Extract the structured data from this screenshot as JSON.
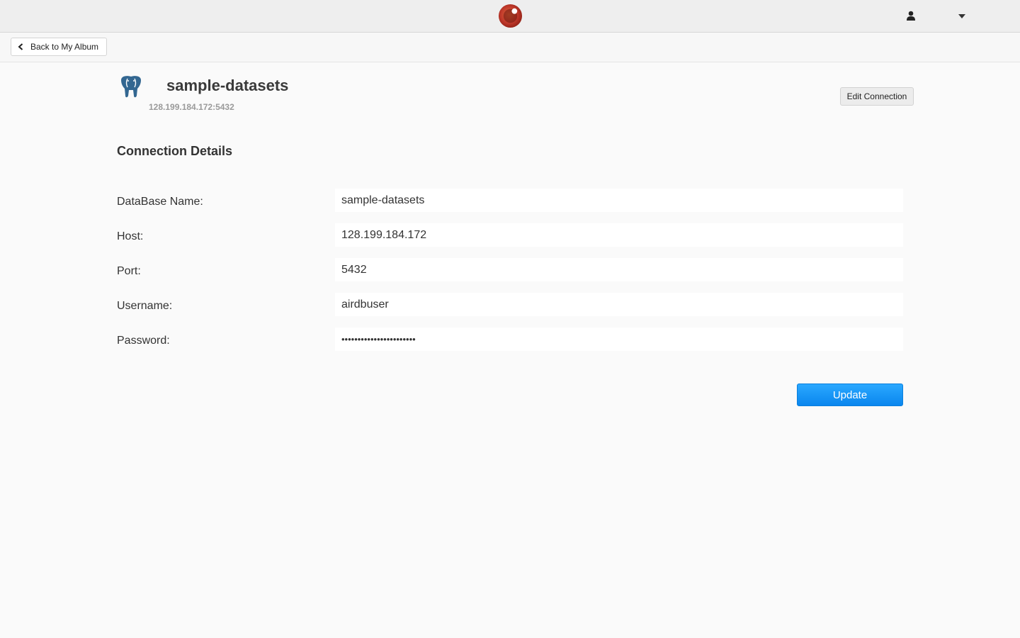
{
  "header": {
    "logo_icon": "app-logo-icon",
    "user_icon": "user-icon",
    "menu_icon": "chevron-down-icon"
  },
  "nav": {
    "back_label": "Back to My Album"
  },
  "connection": {
    "name": "sample-datasets",
    "address": "128.199.184.172:5432",
    "edit_label": "Edit Connection",
    "icon": "postgresql-elephant-icon"
  },
  "details": {
    "section_title": "Connection Details",
    "fields": [
      {
        "label": "DataBase Name:",
        "value": "sample-datasets"
      },
      {
        "label": "Host:",
        "value": "128.199.184.172"
      },
      {
        "label": "Port:",
        "value": "5432"
      },
      {
        "label": "Username:",
        "value": "airdbuser"
      },
      {
        "label": "Password:",
        "value": "•••••••••••••••••••••••"
      }
    ],
    "submit_label": "Update"
  },
  "colors": {
    "primary": "#1a97f7",
    "logo_red": "#c0392b"
  }
}
